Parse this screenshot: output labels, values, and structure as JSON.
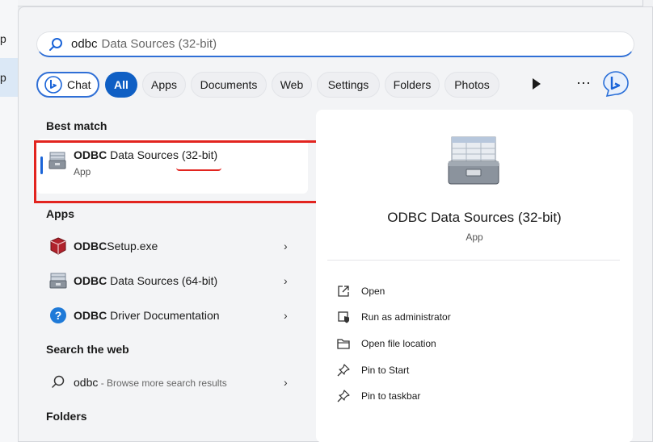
{
  "background": {
    "left_letters": [
      "p",
      "p"
    ]
  },
  "search": {
    "query": "odbc",
    "suggestion_rest": "Data Sources (32-bit)",
    "icon": "search-icon"
  },
  "filters": {
    "chat_label": "Chat",
    "chips": [
      "All",
      "Apps",
      "Documents",
      "Web",
      "Settings",
      "Folders",
      "Photos"
    ],
    "more_label": "⋯"
  },
  "best_match": {
    "heading": "Best match",
    "name_bold": "ODBC",
    "name_rest": " Data Sources (32-bit)",
    "type": "App",
    "icon": "odbc-datasource-icon"
  },
  "apps": {
    "heading": "Apps",
    "items": [
      {
        "name_bold": "ODBC",
        "name_rest": "Setup.exe",
        "icon": "setup-box-icon"
      },
      {
        "name_bold": "ODBC",
        "name_rest": " Data Sources (64-bit)",
        "icon": "odbc-datasource-icon"
      },
      {
        "name_bold": "ODBC",
        "name_rest": " Driver Documentation",
        "icon": "help-icon"
      }
    ]
  },
  "web": {
    "heading": "Search the web",
    "query": "odbc",
    "suffix": " - Browse more search results",
    "icon": "search-icon"
  },
  "folders": {
    "heading": "Folders"
  },
  "detail": {
    "title": "ODBC Data Sources (32-bit)",
    "type": "App",
    "actions": [
      {
        "label": "Open",
        "icon": "open-external-icon"
      },
      {
        "label": "Run as administrator",
        "icon": "shield-run-icon"
      },
      {
        "label": "Open file location",
        "icon": "folder-icon"
      },
      {
        "label": "Pin to Start",
        "icon": "pin-icon"
      },
      {
        "label": "Pin to taskbar",
        "icon": "pin-icon"
      }
    ]
  },
  "colors": {
    "accent": "#0f5fc4",
    "highlight_annotation": "#e2241f"
  }
}
